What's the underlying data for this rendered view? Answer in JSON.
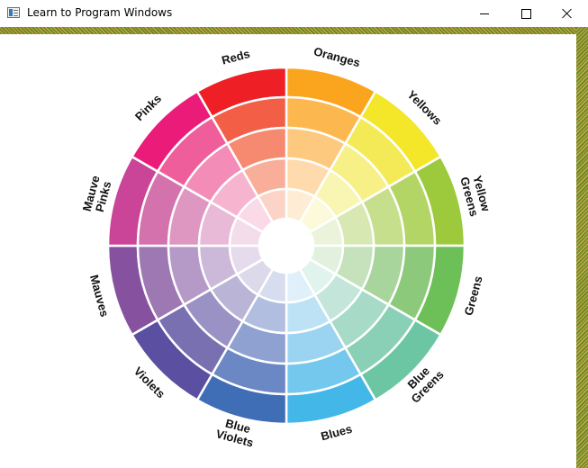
{
  "window": {
    "title": "Learn to Program Windows",
    "icon": "app-window-icon",
    "controls": [
      "minimize-icon",
      "maximize-icon",
      "close-icon"
    ]
  },
  "wheel": {
    "hues": [
      {
        "label": "Oranges",
        "shades": [
          "#fba51f",
          "#fdb74f",
          "#fdc97e",
          "#fedaac",
          "#feecd5"
        ]
      },
      {
        "label": "Yellows",
        "shades": [
          "#f4e629",
          "#f4ea58",
          "#f7f087",
          "#f9f5b3",
          "#fcfadb"
        ]
      },
      {
        "label": "Yellow Greens",
        "shades": [
          "#9dca3c",
          "#b3d566",
          "#c6df8d",
          "#d7e8b2",
          "#ebf4da"
        ]
      },
      {
        "label": "Greens",
        "shades": [
          "#6dbf58",
          "#8dc97b",
          "#a8d59b",
          "#c5e2bc",
          "#e2f1de"
        ]
      },
      {
        "label": "Blue Greens",
        "shades": [
          "#6cc6a4",
          "#8ad0b6",
          "#a7dbc8",
          "#c4e6da",
          "#e1f3ed"
        ]
      },
      {
        "label": "Blues",
        "shades": [
          "#43b7e8",
          "#74c7ed",
          "#9bd4f1",
          "#bee2f5",
          "#dff0fa"
        ]
      },
      {
        "label": "Blue Violets",
        "shades": [
          "#3f6db6",
          "#6b87c4",
          "#8ea1d0",
          "#b1bedf",
          "#d7ddef"
        ]
      },
      {
        "label": "Violets",
        "shades": [
          "#5a4fa0",
          "#7970b2",
          "#9a91c4",
          "#bab4d7",
          "#dcd9eb"
        ]
      },
      {
        "label": "Mauves",
        "shades": [
          "#8652a0",
          "#9e78b3",
          "#b599c6",
          "#ccb8d8",
          "#e6dbec"
        ]
      },
      {
        "label": "Mauve Pinks",
        "shades": [
          "#ca4597",
          "#d472ae",
          "#de97c1",
          "#e8bad7",
          "#f4ddeb"
        ]
      },
      {
        "label": "Pinks",
        "shades": [
          "#eb1b7a",
          "#ef5e9a",
          "#f38cb6",
          "#f7b4cf",
          "#fbdae8"
        ]
      },
      {
        "label": "Reds",
        "shades": [
          "#ee2025",
          "#f25f46",
          "#f58a70",
          "#f8ae99",
          "#fbd4c7"
        ]
      }
    ]
  }
}
